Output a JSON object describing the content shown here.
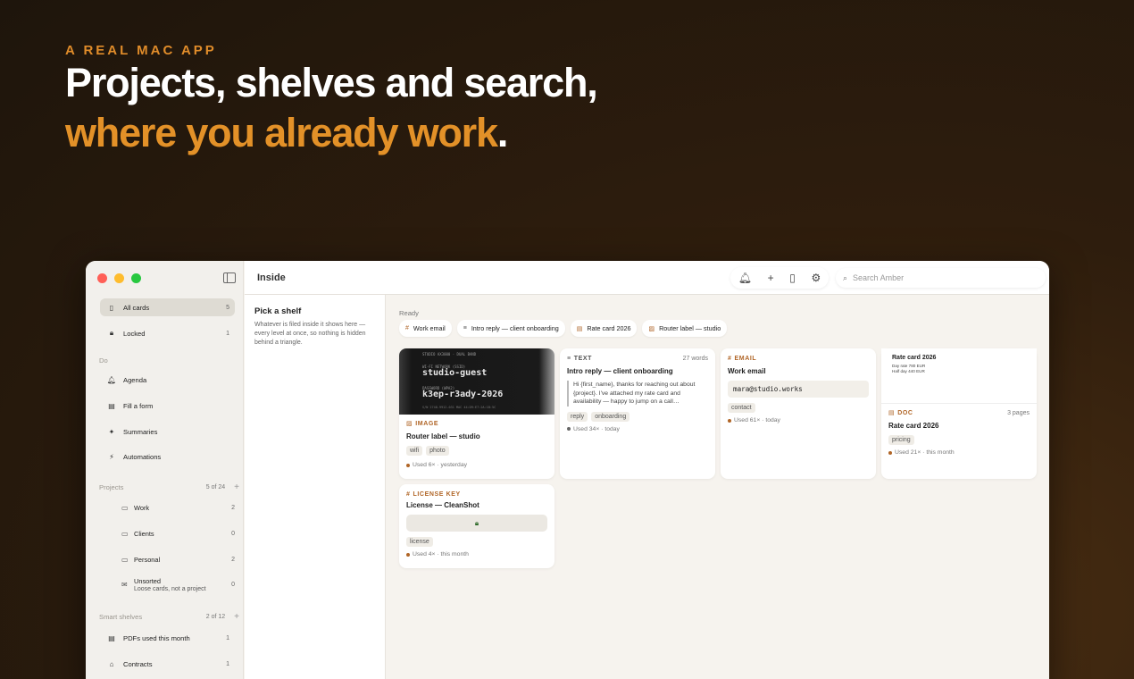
{
  "hero": {
    "eyebrow": "A REAL MAC APP",
    "line1": "Projects, shelves and search,",
    "line2_accent": "where you already work",
    "line2_end": "."
  },
  "colors": {
    "accent": "#e39128",
    "traffic": [
      "#ff5f57",
      "#febc2e",
      "#28c840"
    ]
  },
  "toolbar": {
    "title": "Inside",
    "icons": [
      "bell-icon",
      "plus-icon",
      "book-icon",
      "gear-icon"
    ],
    "search_placeholder": "Search Amber"
  },
  "sidebar": {
    "top": [
      {
        "label": "All cards",
        "count": "5",
        "icon": "clipboard-icon"
      },
      {
        "label": "Locked",
        "count": "1",
        "icon": "lock-icon"
      }
    ],
    "do_heading": "Do",
    "do_items": [
      {
        "label": "Agenda",
        "icon": "bell-icon"
      },
      {
        "label": "Fill a form",
        "icon": "form-icon"
      },
      {
        "label": "Summaries",
        "icon": "sparkle-icon"
      },
      {
        "label": "Automations",
        "icon": "automation-icon"
      }
    ],
    "projects": {
      "heading": "Projects",
      "count": "5 of 24"
    },
    "project_items": [
      {
        "label": "Work",
        "count": "2"
      },
      {
        "label": "Clients",
        "count": "0"
      },
      {
        "label": "Personal",
        "count": "2"
      },
      {
        "label": "Unsorted",
        "sub": "Loose cards, not a project",
        "count": "0"
      }
    ],
    "shelves": {
      "heading": "Smart shelves",
      "count": "2 of 12"
    },
    "shelf_items": [
      {
        "label": "PDFs used this month",
        "count": "1"
      },
      {
        "label": "Contracts",
        "count": "1"
      }
    ]
  },
  "shelf_panel": {
    "title": "Pick a shelf",
    "desc": "Whatever is filed inside it shows here — every level at once, so nothing is hidden behind a triangle."
  },
  "main": {
    "status": "Ready",
    "chips": [
      {
        "label": "Work email",
        "icon": "#"
      },
      {
        "label": "Intro reply — client onboarding",
        "icon": "≡"
      },
      {
        "label": "Rate card 2026",
        "icon": "▤"
      },
      {
        "label": "Router label — studio",
        "icon": "▨"
      }
    ],
    "cards": {
      "router": {
        "kind": "IMAGE",
        "title": "Router label — studio",
        "tags": [
          "wifi",
          "photo"
        ],
        "usage": "Used 6× · yesterday",
        "photo": {
          "brand": "STUDIO AX3000 · DUAL BAND",
          "ssid_label": "WI-FI NETWORK (SSID)",
          "ssid": "studio-guest",
          "pw_label": "PASSWORD (WPA2)",
          "pw": "k3ep-r3ady-2026",
          "footer": "S/N 2748-9912-031     MAC 44:D9:E7:2A:1B:5C"
        }
      },
      "intro": {
        "kind": "TEXT",
        "extra": "27 words",
        "title": "Intro reply — client onboarding",
        "quote": "Hi {first_name}, thanks for reaching out about {project}. I've attached my rate card and availability — happy to jump on a call…",
        "tags": [
          "reply",
          "onboarding"
        ],
        "usage": "Used 34× · today"
      },
      "email": {
        "kind": "EMAIL",
        "title": "Work email",
        "value": "mara@studio.works",
        "tags": [
          "contact"
        ],
        "usage": "Used 61× · today"
      },
      "rate": {
        "preview_title": "Rate card 2026",
        "preview_lines": [
          "Day rate 780 EUR",
          "Half day 440 EUR"
        ],
        "kind": "DOC",
        "extra": "3 pages",
        "title": "Rate card 2026",
        "tags": [
          "pricing"
        ],
        "usage": "Used 21× · this month"
      },
      "license": {
        "kind": "LICENSE KEY",
        "title": "License — CleanShot",
        "tags": [
          "license"
        ],
        "usage": "Used 4× · this month"
      }
    }
  }
}
